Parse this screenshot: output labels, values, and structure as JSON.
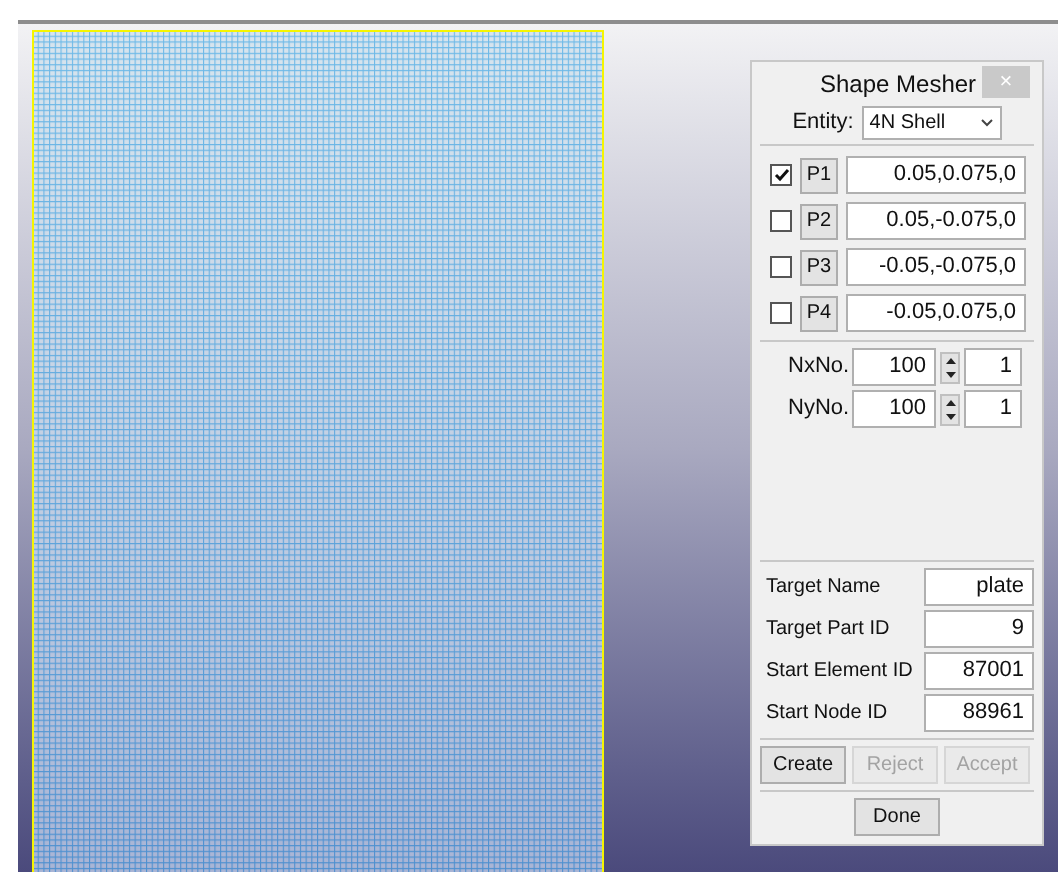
{
  "dialog": {
    "title": "Shape Mesher",
    "close": "×",
    "entity": {
      "label": "Entity:",
      "value": "4N Shell"
    },
    "points": [
      {
        "label": "P1",
        "checked": true,
        "value": "0.05,0.075,0"
      },
      {
        "label": "P2",
        "checked": false,
        "value": "0.05,-0.075,0"
      },
      {
        "label": "P3",
        "checked": false,
        "value": "-0.05,-0.075,0"
      },
      {
        "label": "P4",
        "checked": false,
        "value": "-0.05,0.075,0"
      }
    ],
    "divisions": [
      {
        "label": "NxNo.",
        "value": "100",
        "ratio": "1"
      },
      {
        "label": "NyNo.",
        "value": "100",
        "ratio": "1"
      }
    ],
    "targets": [
      {
        "label": "Target Name",
        "value": "plate"
      },
      {
        "label": "Target Part ID",
        "value": "9"
      },
      {
        "label": "Start Element ID",
        "value": "87001"
      },
      {
        "label": "Start Node ID",
        "value": "88961"
      }
    ],
    "actions": [
      {
        "label": "Create",
        "disabled": false
      },
      {
        "label": "Reject",
        "disabled": true
      },
      {
        "label": "Accept",
        "disabled": true
      }
    ],
    "done": "Done"
  }
}
